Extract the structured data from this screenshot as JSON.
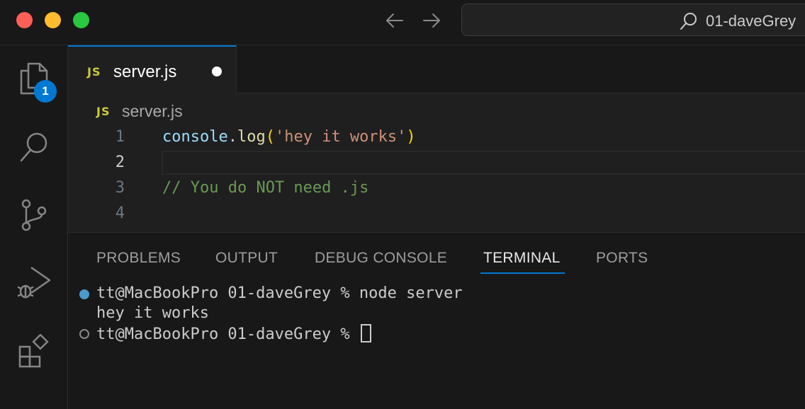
{
  "window": {
    "search_text": "01-daveGrey"
  },
  "activity_bar": {
    "explorer_badge": "1",
    "items": [
      "explorer",
      "search",
      "source-control",
      "run-and-debug",
      "extensions"
    ]
  },
  "tabs": [
    {
      "icon": "JS",
      "label": "server.js",
      "unsaved": true
    }
  ],
  "breadcrumb": {
    "icon": "JS",
    "label": "server.js"
  },
  "editor": {
    "current_line": 2,
    "lines": [
      {
        "number": "1",
        "text": "console.log('hey it works')"
      },
      {
        "number": "2",
        "text": ""
      },
      {
        "number": "3",
        "text": "// You do NOT need .js"
      },
      {
        "number": "4",
        "text": ""
      }
    ],
    "line1_parts": {
      "obj": "console",
      "dot": ".",
      "fn": "log",
      "open": "(",
      "str": "'hey it works'",
      "close": ")"
    }
  },
  "panel": {
    "tabs": [
      "PROBLEMS",
      "OUTPUT",
      "DEBUG CONSOLE",
      "TERMINAL",
      "PORTS"
    ],
    "active_tab": "TERMINAL",
    "terminal": {
      "line1": "tt@MacBookPro 01-daveGrey % node server",
      "line2": "hey it works",
      "line3": "tt@MacBookPro 01-daveGrey % "
    }
  },
  "colors": {
    "accent": "#0078d4",
    "js_badge": "#cbcb41",
    "traffic_red": "#ff5f57",
    "traffic_yellow": "#febc2e",
    "traffic_green": "#28c840"
  }
}
